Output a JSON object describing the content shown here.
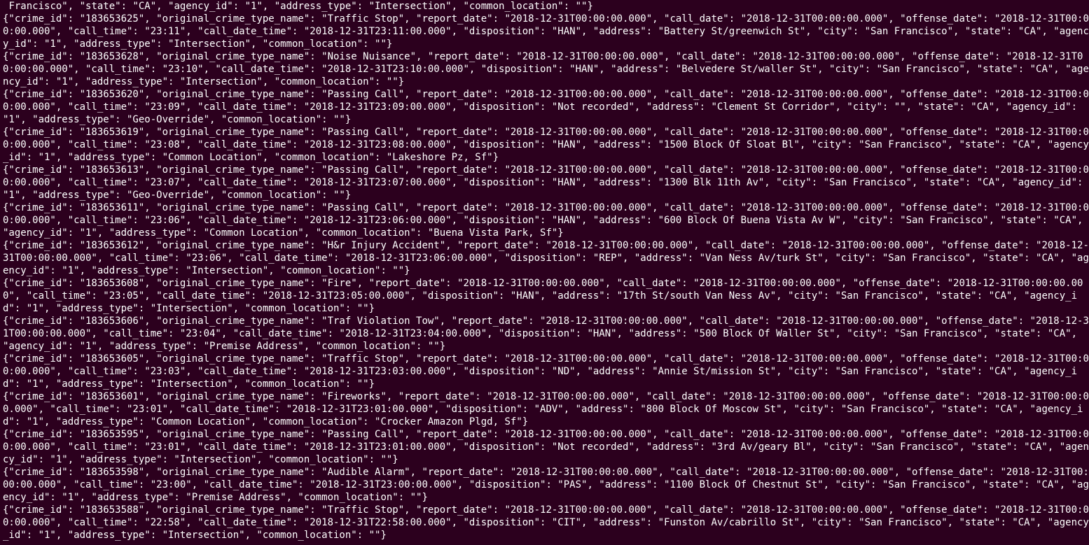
{
  "partial_leading_line": " Francisco\", \"state\": \"CA\", \"agency_id\": \"1\", \"address_type\": \"Intersection\", \"common_location\": \"\"}",
  "records": [
    {
      "crime_id": "183653625",
      "original_crime_type_name": "Traffic Stop",
      "report_date": "2018-12-31T00:00:00.000",
      "call_date": "2018-12-31T00:00:00.000",
      "offense_date": "2018-12-31T00:00:00.000",
      "call_time": "23:11",
      "call_date_time": "2018-12-31T23:11:00.000",
      "disposition": "HAN",
      "address": "Battery St/greenwich St",
      "city": "San Francisco",
      "state": "CA",
      "agency_id": "1",
      "address_type": "Intersection",
      "common_location": ""
    },
    {
      "crime_id": "183653628",
      "original_crime_type_name": "Noise Nuisance",
      "report_date": "2018-12-31T00:00:00.000",
      "call_date": "2018-12-31T00:00:00.000",
      "offense_date": "2018-12-31T00:00:00.000",
      "call_time": "23:10",
      "call_date_time": "2018-12-31T23:10:00.000",
      "disposition": "HAN",
      "address": "Belvedere St/waller St",
      "city": "San Francisco",
      "state": "CA",
      "agency_id": "1",
      "address_type": "Intersection",
      "common_location": ""
    },
    {
      "crime_id": "183653620",
      "original_crime_type_name": "Passing Call",
      "report_date": "2018-12-31T00:00:00.000",
      "call_date": "2018-12-31T00:00:00.000",
      "offense_date": "2018-12-31T00:00:00.000",
      "call_time": "23:09",
      "call_date_time": "2018-12-31T23:09:00.000",
      "disposition": "Not recorded",
      "address": "Clement St Corridor",
      "city": "",
      "state": "CA",
      "agency_id": "1",
      "address_type": "Geo-Override",
      "common_location": ""
    },
    {
      "crime_id": "183653619",
      "original_crime_type_name": "Passing Call",
      "report_date": "2018-12-31T00:00:00.000",
      "call_date": "2018-12-31T00:00:00.000",
      "offense_date": "2018-12-31T00:00:00.000",
      "call_time": "23:08",
      "call_date_time": "2018-12-31T23:08:00.000",
      "disposition": "HAN",
      "address": "1500 Block Of Sloat Bl",
      "city": "San Francisco",
      "state": "CA",
      "agency_id": "1",
      "address_type": "Common Location",
      "common_location": "Lakeshore Pz, Sf"
    },
    {
      "crime_id": "183653613",
      "original_crime_type_name": "Passing Call",
      "report_date": "2018-12-31T00:00:00.000",
      "call_date": "2018-12-31T00:00:00.000",
      "offense_date": "2018-12-31T00:00:00.000",
      "call_time": "23:07",
      "call_date_time": "2018-12-31T23:07:00.000",
      "disposition": "HAN",
      "address": "1300 Blk 11th Av",
      "city": "San Francisco",
      "state": "CA",
      "agency_id": "1",
      "address_type": "Geo-Override",
      "common_location": ""
    },
    {
      "crime_id": "183653611",
      "original_crime_type_name": "Passing Call",
      "report_date": "2018-12-31T00:00:00.000",
      "call_date": "2018-12-31T00:00:00.000",
      "offense_date": "2018-12-31T00:00:00.000",
      "call_time": "23:06",
      "call_date_time": "2018-12-31T23:06:00.000",
      "disposition": "HAN",
      "address": "600 Block Of Buena Vista Av W",
      "city": "San Francisco",
      "state": "CA",
      "agency_id": "1",
      "address_type": "Common Location",
      "common_location": "Buena Vista Park, Sf"
    },
    {
      "crime_id": "183653612",
      "original_crime_type_name": "H&r Injury Accident",
      "report_date": "2018-12-31T00:00:00.000",
      "call_date": "2018-12-31T00:00:00.000",
      "offense_date": "2018-12-31T00:00:00.000",
      "call_time": "23:06",
      "call_date_time": "2018-12-31T23:06:00.000",
      "disposition": "REP",
      "address": "Van Ness Av/turk St",
      "city": "San Francisco",
      "state": "CA",
      "agency_id": "1",
      "address_type": "Intersection",
      "common_location": ""
    },
    {
      "crime_id": "183653608",
      "original_crime_type_name": "Fire",
      "report_date": "2018-12-31T00:00:00.000",
      "call_date": "2018-12-31T00:00:00.000",
      "offense_date": "2018-12-31T00:00:00.000",
      "call_time": "23:05",
      "call_date_time": "2018-12-31T23:05:00.000",
      "disposition": "HAN",
      "address": "17th St/south Van Ness Av",
      "city": "San Francisco",
      "state": "CA",
      "agency_id": "1",
      "address_type": "Intersection",
      "common_location": ""
    },
    {
      "crime_id": "183653606",
      "original_crime_type_name": "Traf Violation Tow",
      "report_date": "2018-12-31T00:00:00.000",
      "call_date": "2018-12-31T00:00:00.000",
      "offense_date": "2018-12-31T00:00:00.000",
      "call_time": "23:04",
      "call_date_time": "2018-12-31T23:04:00.000",
      "disposition": "HAN",
      "address": "500 Block Of Waller St",
      "city": "San Francisco",
      "state": "CA",
      "agency_id": "1",
      "address_type": "Premise Address",
      "common_location": ""
    },
    {
      "crime_id": "183653605",
      "original_crime_type_name": "Traffic Stop",
      "report_date": "2018-12-31T00:00:00.000",
      "call_date": "2018-12-31T00:00:00.000",
      "offense_date": "2018-12-31T00:00:00.000",
      "call_time": "23:03",
      "call_date_time": "2018-12-31T23:03:00.000",
      "disposition": "ND",
      "address": "Annie St/mission St",
      "city": "San Francisco",
      "state": "CA",
      "agency_id": "1",
      "address_type": "Intersection",
      "common_location": ""
    },
    {
      "crime_id": "183653601",
      "original_crime_type_name": "Fireworks",
      "report_date": "2018-12-31T00:00:00.000",
      "call_date": "2018-12-31T00:00:00.000",
      "offense_date": "2018-12-31T00:00:00.000",
      "call_time": "23:01",
      "call_date_time": "2018-12-31T23:01:00.000",
      "disposition": "ADV",
      "address": "800 Block Of Moscow St",
      "city": "San Francisco",
      "state": "CA",
      "agency_id": "1",
      "address_type": "Common Location",
      "common_location": "Crocker Amazon Plgd, Sf"
    },
    {
      "crime_id": "183653595",
      "original_crime_type_name": "Passing Call",
      "report_date": "2018-12-31T00:00:00.000",
      "call_date": "2018-12-31T00:00:00.000",
      "offense_date": "2018-12-31T00:00:00.000",
      "call_time": "23:01",
      "call_date_time": "2018-12-31T23:01:00.000",
      "disposition": "Not recorded",
      "address": "3rd Av/geary Bl",
      "city": "San Francisco",
      "state": "CA",
      "agency_id": "1",
      "address_type": "Intersection",
      "common_location": ""
    },
    {
      "crime_id": "183653598",
      "original_crime_type_name": "Audible Alarm",
      "report_date": "2018-12-31T00:00:00.000",
      "call_date": "2018-12-31T00:00:00.000",
      "offense_date": "2018-12-31T00:00:00.000",
      "call_time": "23:00",
      "call_date_time": "2018-12-31T23:00:00.000",
      "disposition": "PAS",
      "address": "1100 Block Of Chestnut St",
      "city": "San Francisco",
      "state": "CA",
      "agency_id": "1",
      "address_type": "Premise Address",
      "common_location": ""
    },
    {
      "crime_id": "183653588",
      "original_crime_type_name": "Traffic Stop",
      "report_date": "2018-12-31T00:00:00.000",
      "call_date": "2018-12-31T00:00:00.000",
      "offense_date": "2018-12-31T00:00:00.000",
      "call_time": "22:58",
      "call_date_time": "2018-12-31T22:58:00.000",
      "disposition": "CIT",
      "address": "Funston Av/cabrillo St",
      "city": "San Francisco",
      "state": "CA",
      "agency_id": "1",
      "address_type": "Intersection",
      "common_location": ""
    }
  ],
  "field_order": [
    "crime_id",
    "original_crime_type_name",
    "report_date",
    "call_date",
    "offense_date",
    "call_time",
    "call_date_time",
    "disposition",
    "address",
    "city",
    "state",
    "agency_id",
    "address_type",
    "common_location"
  ]
}
